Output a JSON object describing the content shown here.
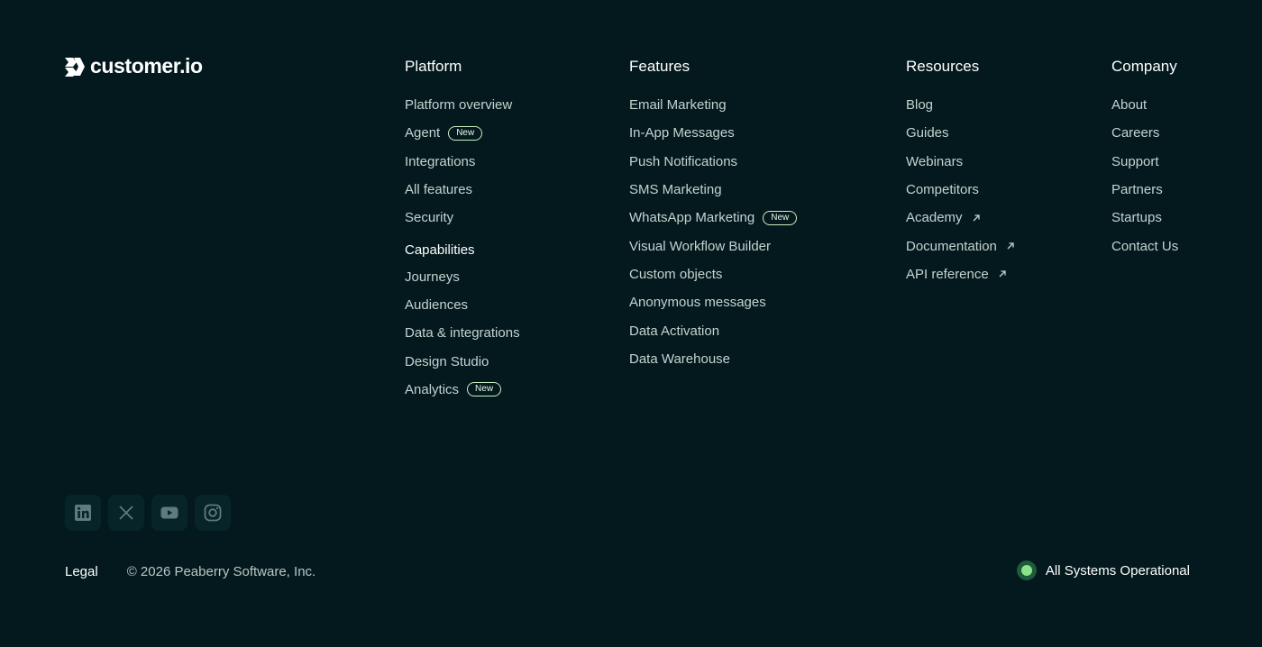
{
  "logo": {
    "text": "customer.io"
  },
  "columns": {
    "platform": {
      "heading": "Platform",
      "items": [
        {
          "label": "Platform overview"
        },
        {
          "label": "Agent",
          "badge": "New"
        },
        {
          "label": "Integrations"
        },
        {
          "label": "All features"
        },
        {
          "label": "Security"
        }
      ],
      "subheading": "Capabilities",
      "sub_items": [
        {
          "label": "Journeys"
        },
        {
          "label": "Audiences"
        },
        {
          "label": "Data & integrations"
        },
        {
          "label": "Design Studio"
        },
        {
          "label": "Analytics",
          "badge": "New"
        }
      ]
    },
    "features": {
      "heading": "Features",
      "items": [
        {
          "label": "Email Marketing"
        },
        {
          "label": "In-App Messages"
        },
        {
          "label": "Push Notifications"
        },
        {
          "label": "SMS Marketing"
        },
        {
          "label": "WhatsApp Marketing",
          "badge": "New"
        },
        {
          "label": "Visual Workflow Builder"
        },
        {
          "label": "Custom objects"
        },
        {
          "label": "Anonymous messages"
        },
        {
          "label": "Data Activation"
        },
        {
          "label": "Data Warehouse"
        }
      ]
    },
    "resources": {
      "heading": "Resources",
      "items": [
        {
          "label": "Blog"
        },
        {
          "label": "Guides"
        },
        {
          "label": "Webinars"
        },
        {
          "label": "Competitors"
        },
        {
          "label": "Academy",
          "icon": "external-link-icon"
        },
        {
          "label": "Documentation",
          "icon": "external-link-icon"
        },
        {
          "label": "API reference",
          "icon": "external-link-icon"
        }
      ]
    },
    "company": {
      "heading": "Company",
      "items": [
        {
          "label": "About"
        },
        {
          "label": "Careers"
        },
        {
          "label": "Support"
        },
        {
          "label": "Partners"
        },
        {
          "label": "Startups"
        },
        {
          "label": "Contact Us"
        }
      ]
    }
  },
  "socials": [
    {
      "icon": "linkedin-icon"
    },
    {
      "icon": "x-twitter-icon"
    },
    {
      "icon": "youtube-icon"
    },
    {
      "icon": "instagram-icon"
    }
  ],
  "bottom": {
    "legal": "Legal",
    "copyright": "© 2026 Peaberry Software, Inc.",
    "status": "All Systems Operational"
  },
  "colors": {
    "background": "#03191e",
    "text": "#c5d3cf",
    "heading": "#ffffff",
    "badge_border": "#c9f0c2",
    "status_dot": "#8be489",
    "social_bg": "#072428"
  }
}
